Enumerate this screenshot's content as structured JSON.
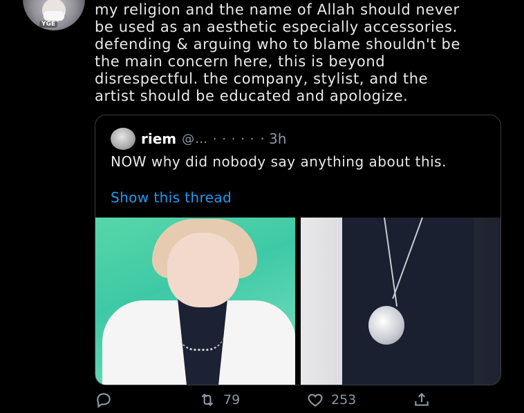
{
  "author": {
    "avatar_badge": "YGE"
  },
  "tweet": {
    "text": "my religion and the name of Allah should never\nbe used as an aesthetic especially accessories.\ndefending & arguing who to blame shouldn't be\nthe main concern here, this is beyond\ndisrespectful. the company, stylist, and the\nartist should be educated and apologize."
  },
  "quote": {
    "name": "riem",
    "handle": "@… · · · · ·",
    "time": "· 3h",
    "text": "NOW why did nobody say anything about this.",
    "show_thread": "Show this thread"
  },
  "actions": {
    "reply_count": "",
    "retweet_count": "79",
    "like_count": "253"
  },
  "icons": {
    "reply": "reply-icon",
    "retweet": "retweet-icon",
    "like": "heart-icon",
    "share": "share-icon"
  },
  "colors": {
    "background": "#000000",
    "text": "#e7e9ea",
    "muted": "#8b98a5",
    "link": "#1d9bf0",
    "border": "#3a3d41"
  }
}
